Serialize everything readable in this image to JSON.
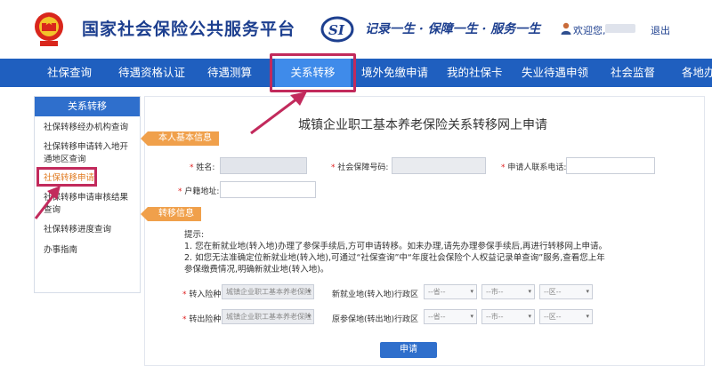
{
  "header": {
    "site_title": "国家社会保险公共服务平台",
    "slogan": "记录一生 · 保障一生 · 服务一生",
    "welcome": "欢迎您,",
    "logout": "退出"
  },
  "nav": {
    "items": [
      "社保查询",
      "待遇资格认证",
      "待遇测算",
      "关系转移",
      "境外免缴申请",
      "我的社保卡",
      "失业待遇申领",
      "社会监督",
      "各地办"
    ],
    "active_index": 3
  },
  "sidebar": {
    "title": "关系转移",
    "items": [
      "社保转移经办机构查询",
      "社保转移申请转入地开通地区查询",
      "社保转移申请",
      "社保转移申请审核结果查询",
      "社保转移进度查询",
      "办事指南"
    ],
    "current_index": 2
  },
  "form": {
    "title": "城镇企业职工基本养老保险关系转移网上申请",
    "section_basic": "本人基本信息",
    "section_transfer": "转移信息",
    "name_label": "姓名:",
    "ssn_label": "社会保障号码:",
    "phone_label": "申请人联系电话:",
    "hukou_label": "户籍地址:",
    "tips_title": "提示:",
    "tip1": "1. 您在新就业地(转入地)办理了参保手续后,方可申请转移。如未办理,请先办理参保手续后,再进行转移网上申请。",
    "tip2": "2. 如您无法准确定位新就业地(转入地),可通过“社保查询”中“年度社会保险个人权益记录单查询”服务,查看您上年参保缴费情况,明确新就业地(转入地)。",
    "in_type_label": "转入险种",
    "in_type_value": "城镇企业职工基本养老保险",
    "out_type_label": "转出险种",
    "out_type_value": "城镇企业职工基本养老保险",
    "new_region_label": "新就业地(转入地)行政区",
    "old_region_label": "原参保地(转出地)行政区",
    "province_placeholder": "--省--",
    "city_placeholder": "--市--",
    "district_placeholder": "--区--",
    "submit": "申请"
  },
  "colors": {
    "brand": "#1f5fbf",
    "accent": "#f0a04b",
    "highlight": "#c22a5c"
  }
}
